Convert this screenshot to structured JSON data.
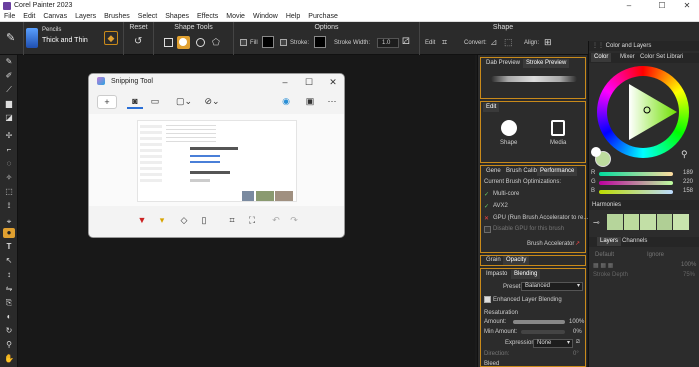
{
  "app": {
    "title": "Corel Painter 2023"
  },
  "menu": [
    "File",
    "Edit",
    "Canvas",
    "Layers",
    "Brushes",
    "Select",
    "Shapes",
    "Effects",
    "Movie",
    "Window",
    "Help",
    "Purchase"
  ],
  "propbar": {
    "brush_category": "Pencils",
    "brush_variant": "Thick and Thin",
    "reset_label": "Reset",
    "shape_tools_label": "Shape Tools",
    "options_label": "Options",
    "fill_label": "Fill",
    "stroke_label": "Stroke:",
    "stroke_width_label": "Stroke Width:",
    "stroke_width_value": "1.0",
    "shape_label": "Shape",
    "edit_label": "Edit",
    "convert_label": "Convert:",
    "align_label": "Align:"
  },
  "snipping_tool": {
    "title": "Snipping Tool"
  },
  "dab": {
    "tab1": "Dab Preview",
    "tab2": "Stroke Preview"
  },
  "edit": {
    "title": "Edit",
    "shape_label": "Shape",
    "media_label": "Media"
  },
  "perf": {
    "tabs": [
      "Gene",
      "Brush Calib",
      "Performance"
    ],
    "heading": "Current Brush Optimizations:",
    "items": [
      "Multi-core",
      "AVX2",
      "GPU (Run Brush Accelerator to re..."
    ],
    "disable_gpu": "Disable GPU for this brush",
    "accelerator": "Brush Accelerator"
  },
  "grain": {
    "tab1": "Grain",
    "tab2": "Opacity"
  },
  "impasto": {
    "tab1": "Impasto",
    "tab2": "Blending",
    "preset_label": "Preset:",
    "preset_value": "Balanced",
    "enhanced": "Enhanced Layer Blending",
    "resaturation": "Resaturation",
    "amount_label": "Amount:",
    "amount_value": "100%",
    "min_amount_label": "Min Amount:",
    "min_amount_value": "0%",
    "expression_label": "Expression:",
    "expression_value": "None",
    "direction_label": "Direction:",
    "direction_value": "0°",
    "bleed": "Bleed"
  },
  "color_panel": {
    "header": "Color and Layers",
    "tabs": [
      "Color",
      "Mixer",
      "Color Set Librari"
    ],
    "r_label": "R",
    "r_value": "189",
    "g_label": "G",
    "g_value": "220",
    "b_label": "B",
    "b_value": "158",
    "main_color": "#bddc9e"
  },
  "harmonies": {
    "header": "Harmonies"
  },
  "layers": {
    "tabs": [
      "Layers",
      "Channels"
    ],
    "composite": "Default",
    "composite_mode": "Ignore",
    "opacity_value": "100%",
    "depth_label": "Stroke Depth",
    "depth_value": "75%"
  }
}
